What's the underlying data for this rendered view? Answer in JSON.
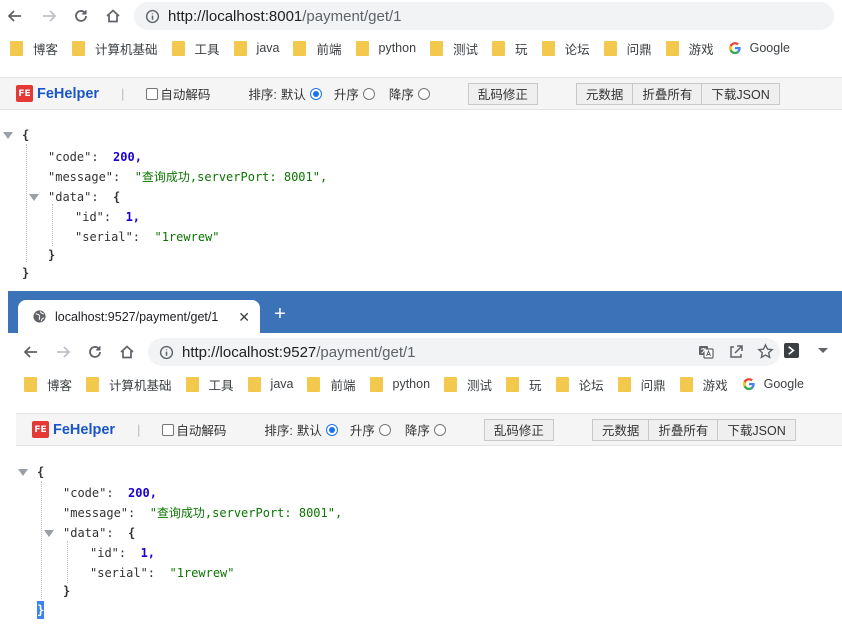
{
  "window1": {
    "url_host": "http://localhost:8001",
    "url_path": "/payment/get/1"
  },
  "window2": {
    "tab_title": "localhost:9527/payment/get/1",
    "tab_close": "✕",
    "new_tab": "+",
    "url_host": "http://localhost:9527",
    "url_path": "/payment/get/1"
  },
  "bookmarks": [
    "博客",
    "计算机基础",
    "工具",
    "java",
    "前端",
    "python",
    "测试",
    "玩",
    "论坛",
    "问鼎",
    "游戏"
  ],
  "google_label": "Google",
  "fehelper": {
    "logo": "FE",
    "name": "FeHelper",
    "separator": "|",
    "autodecode": "自动解码",
    "sort_label": "排序:",
    "sort_default": "默认",
    "sort_asc": "升序",
    "sort_desc": "降序",
    "fix_garbled": "乱码修正",
    "raw_data": "元数据",
    "collapse_all": "折叠所有",
    "download_json": "下载JSON"
  },
  "json": {
    "open_brace": "{",
    "close_brace": "}",
    "code_key": "\"code\":",
    "code_val": "200,",
    "message_key": "\"message\":",
    "message_val": "\"查询成功,serverPort: 8001\",",
    "message_val2": "\"查询成功,serverPort: 8001\",",
    "data_key": "\"data\":",
    "id_key": "\"id\":",
    "id_val": "1,",
    "serial_key": "\"serial\":",
    "serial_val": "\"1rewrew\""
  },
  "colors": {
    "tabstrip": "#3b72b8",
    "fehelper_name": "#1a56c8",
    "number": "#1c00cf",
    "string": "#0b7500",
    "folder": "#f2c94c"
  },
  "icons": [
    "back-icon",
    "forward-icon",
    "reload-icon",
    "home-icon",
    "info-icon",
    "folder-icon",
    "google-icon",
    "globe-icon",
    "translate-icon",
    "share-icon",
    "star-icon",
    "extension-icon",
    "menu-chevron-icon"
  ]
}
